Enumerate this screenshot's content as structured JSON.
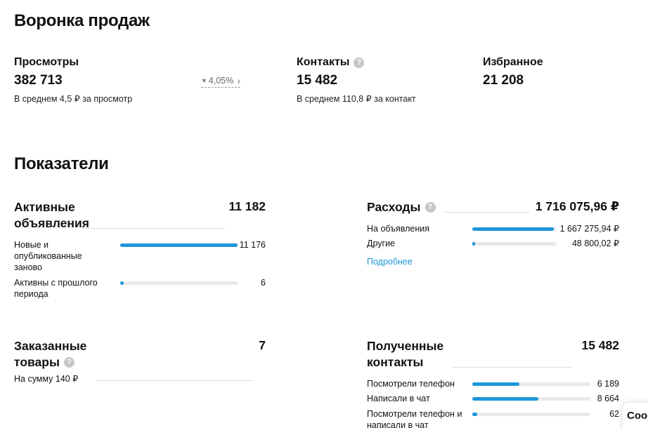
{
  "funnel": {
    "title": "Воронка продаж",
    "views": {
      "label": "Просмотры",
      "value": "382 713",
      "sub": "В среднем 4,5 ₽ за просмотр",
      "trend": "4,05%"
    },
    "contacts": {
      "label": "Контакты",
      "help": "?",
      "value": "15 482",
      "sub": "В среднем 110,8 ₽ за контакт"
    },
    "favorites": {
      "label": "Избранное",
      "value": "21 208"
    }
  },
  "indicators": {
    "title": "Показатели",
    "active": {
      "title_line1": "Активные",
      "title_line2": "объявления",
      "total": "11 182",
      "rows": [
        {
          "label": "Новые и опубликованные заново",
          "value": "11 176",
          "share": 0.995
        },
        {
          "label": "Активны с прошлого периода",
          "value": "6",
          "share": 0.02
        }
      ]
    },
    "expenses": {
      "title": "Расходы",
      "help": "?",
      "total": "1 716 075,96 ₽",
      "rows": [
        {
          "label": "На объявления",
          "value": "1 667 275,94 ₽",
          "share": 0.97
        },
        {
          "label": "Другие",
          "value": "48 800,02 ₽",
          "share": 0.03
        }
      ],
      "more": "Подробнее"
    },
    "orders": {
      "title_line1": "Заказанные",
      "title_line2": "товары",
      "help": "?",
      "total": "7",
      "sub": "На сумму 140 ₽"
    },
    "received": {
      "title_line1": "Полученные",
      "title_line2": "контакты",
      "total": "15 482",
      "rows": [
        {
          "label": "Посмотрели телефон",
          "value": "6 189",
          "share": 0.4
        },
        {
          "label": "Написали в чат",
          "value": "8 664",
          "share": 0.56
        },
        {
          "label": "Посмотрели телефон и написали в чат",
          "value": "62",
          "share": 0.04
        }
      ]
    }
  },
  "cookie": {
    "text": "Coo"
  }
}
